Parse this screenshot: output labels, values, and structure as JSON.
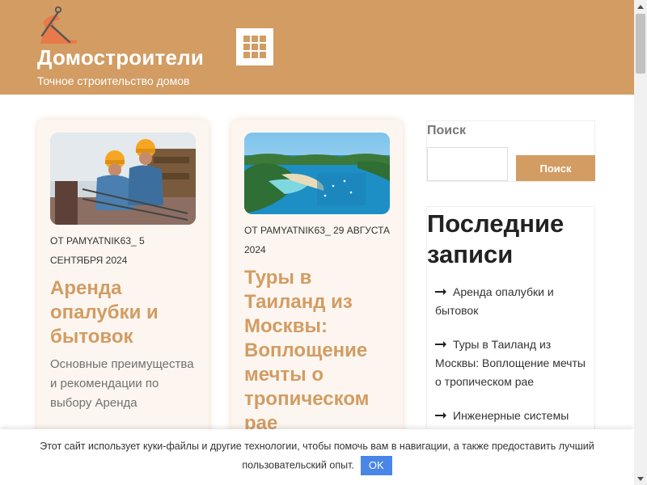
{
  "header": {
    "site_title": "Домостроители",
    "site_description": "Точное строительство домов",
    "logo_icon": "construction-worker-icon",
    "menu_icon": "grid-menu-icon",
    "background_color": "#d29c63"
  },
  "posts": [
    {
      "meta": "ОТ PAMYATNIK63_   5 СЕНТЯБРЯ 2024",
      "title": "Аренда опалубки и бытовок",
      "excerpt": "Основные преимущества и рекомендации по выбору Аренда",
      "image": "construction-workers-photo"
    },
    {
      "meta": "ОТ PAMYATNIK63_   29 АВГУСТА 2024",
      "title": "Туры в Таиланд из Москвы: Воплощение мечты о тропическом рае",
      "excerpt": "",
      "image": "tropical-island-photo"
    }
  ],
  "sidebar": {
    "search": {
      "label": "Поиск",
      "placeholder": "",
      "button_label": "Поиск"
    },
    "recent_posts": {
      "title": "Последние записи",
      "items": [
        "Аренда опалубки и бытовок",
        "Туры в Таиланд из Москвы: Воплощение мечты о тропическом рае",
        "Инженерные системы"
      ]
    }
  },
  "cookie_bar": {
    "text": "Этот сайт использует куки-файлы и другие технологии, чтобы помочь вам в навигации, а также предоставить лучший пользовательский опыт.",
    "ok_label": "OK",
    "ok_color": "#4a86e8"
  }
}
